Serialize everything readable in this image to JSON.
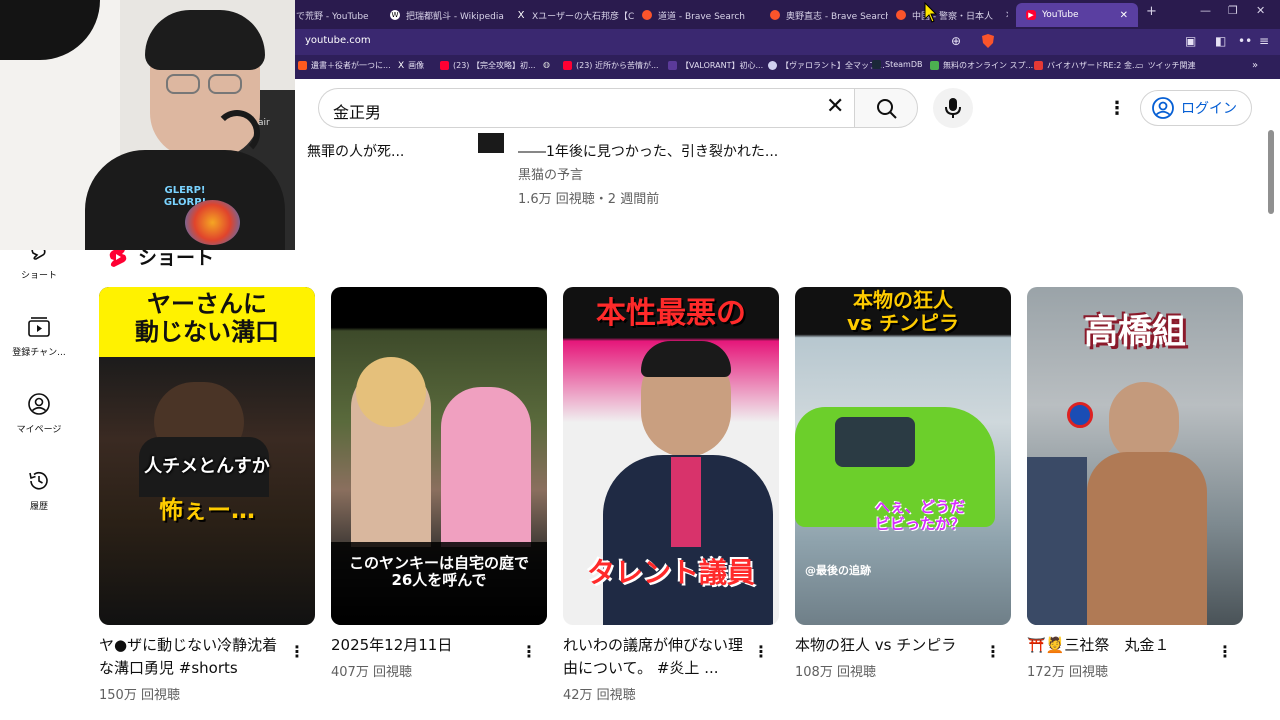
{
  "browser": {
    "tabs": [
      {
        "label": "で荒野 - YouTube",
        "icon": "youtube-icon",
        "color": "#ff0033"
      },
      {
        "label": "把瑞都凱斗 - Wikipedia",
        "icon": "wikipedia-icon",
        "color": "#ffffff"
      },
      {
        "label": "Xユーザーの大石邦彦【CBC】",
        "icon": "x-icon",
        "color": "#ffffff"
      },
      {
        "label": "道道 - Brave Search",
        "icon": "brave-icon",
        "color": "#fb542b"
      },
      {
        "label": "奥野直志 - Brave Search",
        "icon": "brave-icon",
        "color": "#fb542b"
      },
      {
        "label": "中国 - 警察・日本人",
        "icon": "brave-icon",
        "color": "#fb542b"
      },
      {
        "label": "YouTube",
        "icon": "youtube-icon",
        "color": "#ff0033",
        "active": true
      }
    ],
    "new_tab": "+",
    "url": "youtube.com",
    "bookmarks": [
      {
        "label": "遺書＋役者が一つに...",
        "color": "#ff5a1f"
      },
      {
        "label": "画像",
        "color": "#ffffff"
      },
      {
        "label": "(23) 【完全攻略】初...",
        "color": "#ff0033"
      },
      {
        "label": "(23) 近所から苦情が...",
        "color": "#ff0033"
      },
      {
        "label": "【VALORANT】初心...",
        "color": "#5b3a9a"
      },
      {
        "label": "【ヴァロラント】全マップ...",
        "color": "#d0d0f0"
      },
      {
        "label": "SteamDB",
        "color": "#1b2838"
      },
      {
        "label": "無料のオンライン スプ...",
        "color": "#4caf50"
      },
      {
        "label": "バイオハザードRE:2 金...",
        "color": "#e53935"
      },
      {
        "label": "ツイッチ関連",
        "color": "#ffd54f"
      }
    ]
  },
  "search": {
    "query": "金正男"
  },
  "header": {
    "login_label": "ログイン"
  },
  "previous_row": {
    "video1_title": "無罪の人が死...",
    "video2_title": "――1年後に見つかった、引き裂かれた...",
    "video2_channel": "黒猫の予言",
    "video2_meta": "1.6万 回視聴・2 週間前"
  },
  "sidebar": [
    {
      "label": "ショート",
      "icon": "shorts-icon"
    },
    {
      "label": "登録チャン...",
      "icon": "subscriptions-icon"
    },
    {
      "label": "マイページ",
      "icon": "account-icon"
    },
    {
      "label": "履歴",
      "icon": "history-icon"
    }
  ],
  "shorts": {
    "title": "ショート",
    "items": [
      {
        "title": "ヤ●ザに動じない冷静沈着な溝口勇児 #shorts",
        "views": "150万 回視聴",
        "overlay_top": "ヤーさんに\n動じない溝口",
        "overlay_mid": "人チメとんすか",
        "overlay_bottom": "怖ぇー…"
      },
      {
        "title": "2025年12月11日",
        "views": "407万 回視聴",
        "overlay_caption": "このヤンキーは自宅の庭で\n26人を呼んで"
      },
      {
        "title": "れいわの議席が伸びない理由について。 #炎上 ...",
        "views": "42万 回視聴",
        "overlay_top": "本性最悪の",
        "overlay_bottom": "タレント議員"
      },
      {
        "title": "本物の狂人 vs チンピラ",
        "views": "108万 回視聴",
        "overlay_top": "本物の狂人\nvs チンピラ",
        "overlay_mid": "へぇ、どうだ\nビビったか？",
        "overlay_tag": "@最後の追跡"
      },
      {
        "title": "⛩️💆三社祭　丸金１",
        "views": "172万 回視聴",
        "overlay_top": "高橋組"
      }
    ]
  },
  "webcam": {
    "shirt_text": "GLERP!\nGLORP!",
    "logo_text": "air"
  }
}
